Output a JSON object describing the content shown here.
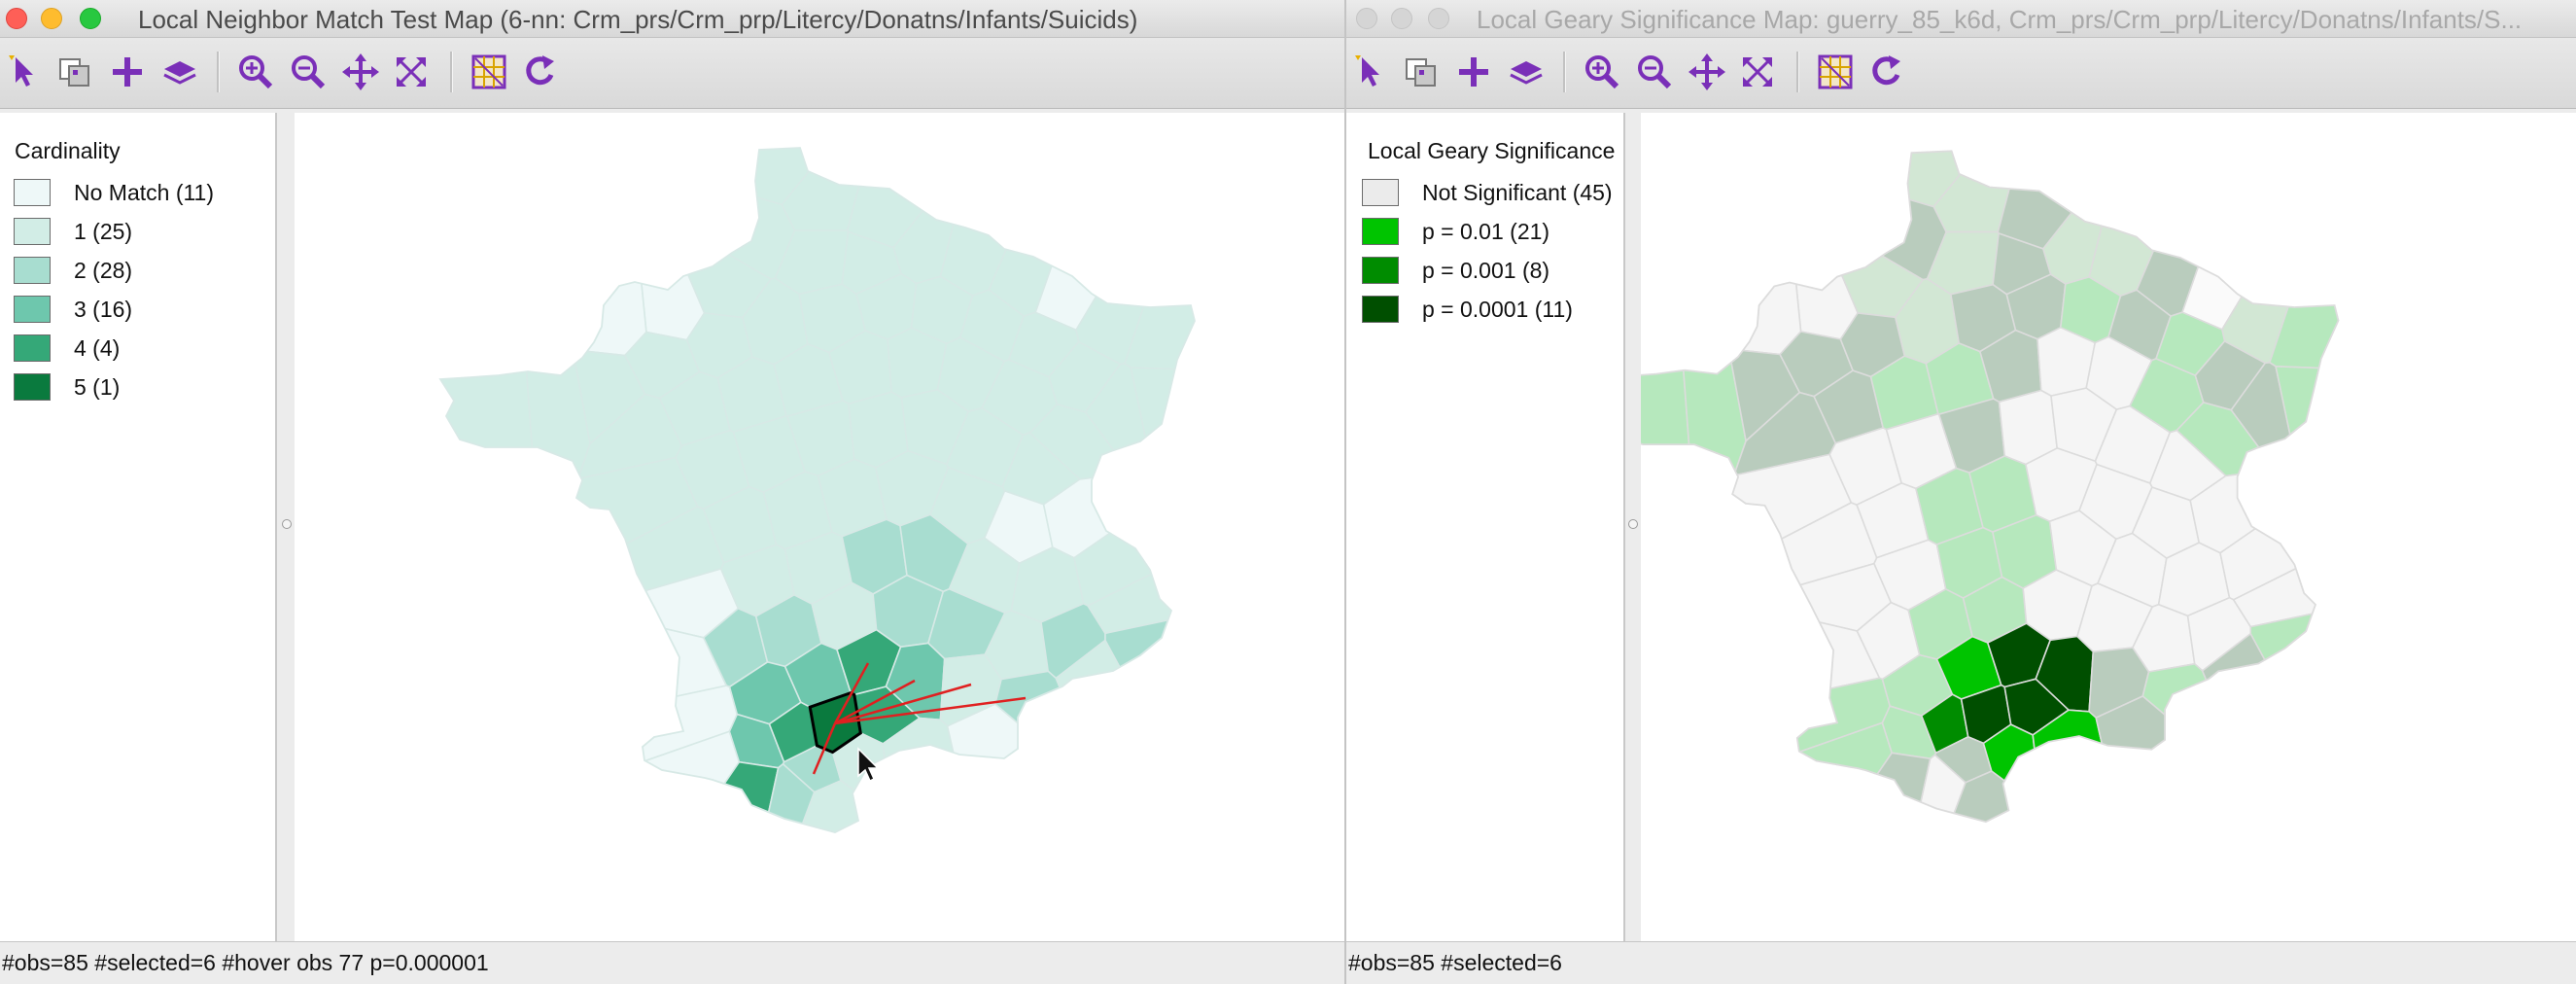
{
  "left_window": {
    "title": "Local Neighbor Match Test Map (6-nn: Crm_prs/Crm_prp/Litercy/Donatns/Infants/Suicids)",
    "legend": {
      "title": "Cardinality",
      "items": [
        {
          "label": "No Match (11)",
          "color": "#eef8f8"
        },
        {
          "label": "1 (25)",
          "color": "#d2ede6"
        },
        {
          "label": "2 (28)",
          "color": "#a8ddd0"
        },
        {
          "label": "3 (16)",
          "color": "#6ec7ad"
        },
        {
          "label": "4 (4)",
          "color": "#35a878"
        },
        {
          "label": "5 (1)",
          "color": "#0a7a3e"
        }
      ]
    },
    "status": "#obs=85 #selected=6  #hover obs 77 p=0.000001"
  },
  "right_window": {
    "title": "Local Geary Significance Map: guerry_85_k6d, Crm_prs/Crm_prp/Litercy/Donatns/Infants/S...",
    "legend": {
      "title": "Local Geary Significance",
      "items": [
        {
          "label": "Not Significant (45)",
          "color": "#ebebeb"
        },
        {
          "label": "p = 0.01 (21)",
          "color": "#00c400"
        },
        {
          "label": "p = 0.001 (8)",
          "color": "#008c00"
        },
        {
          "label": "p = 0.0001 (11)",
          "color": "#004f00"
        }
      ]
    },
    "status": "#obs=85 #selected=6"
  },
  "toolbar_icons": [
    "select-arrow-icon",
    "copy-layer-icon",
    "add-plus-icon",
    "layers-icon",
    "zoom-in-icon",
    "zoom-out-icon",
    "pan-move-icon",
    "fit-extent-icon",
    "selection-grid-icon",
    "refresh-icon"
  ],
  "accent_color": "#7a2fb8",
  "selection_link_color": "#e02020"
}
